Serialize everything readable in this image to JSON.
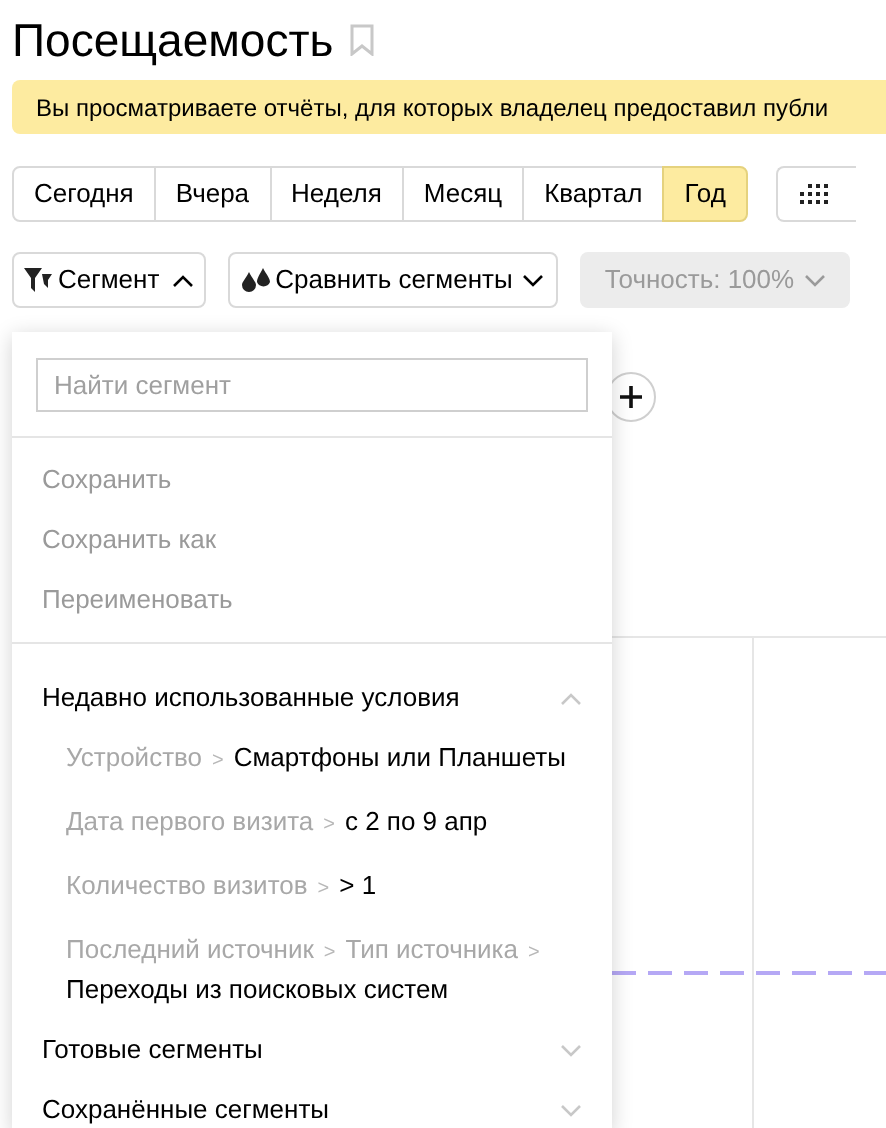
{
  "title": "Посещаемость",
  "banner": "Вы просматриваете отчёты, для которых владелец предоставил публи",
  "periods": [
    {
      "label": "Сегодня",
      "selected": false
    },
    {
      "label": "Вчера",
      "selected": false
    },
    {
      "label": "Неделя",
      "selected": false
    },
    {
      "label": "Месяц",
      "selected": false
    },
    {
      "label": "Квартал",
      "selected": false
    },
    {
      "label": "Год",
      "selected": true
    }
  ],
  "toolbar": {
    "segment": {
      "label": "Сегмент",
      "expanded": true
    },
    "compare": {
      "label": "Сравнить сегменты",
      "expanded": false
    },
    "accuracy": {
      "label": "Точность: 100%",
      "disabled": true
    }
  },
  "dropdown": {
    "search": {
      "placeholder": "Найти сегмент"
    },
    "actions": [
      {
        "label": "Сохранить",
        "disabled": true
      },
      {
        "label": "Сохранить как",
        "disabled": true
      },
      {
        "label": "Переименовать",
        "disabled": true
      }
    ],
    "sections": [
      {
        "title": "Недавно использованные условия",
        "expanded": true,
        "conditions": [
          {
            "parts": [
              {
                "kind": "field",
                "text": "Устройство"
              },
              {
                "kind": "separator",
                "text": ">"
              },
              {
                "kind": "value",
                "text": "Смартфоны или Планшеты"
              }
            ]
          },
          {
            "parts": [
              {
                "kind": "field",
                "text": "Дата первого визита"
              },
              {
                "kind": "separator",
                "text": ">"
              },
              {
                "kind": "value",
                "text": "с 2 по 9 апр"
              }
            ]
          },
          {
            "parts": [
              {
                "kind": "field",
                "text": "Количество визитов"
              },
              {
                "kind": "separator",
                "text": ">"
              },
              {
                "kind": "value",
                "text": "> 1"
              }
            ]
          },
          {
            "parts": [
              {
                "kind": "field",
                "text": "Последний источник"
              },
              {
                "kind": "separator",
                "text": ">"
              },
              {
                "kind": "field",
                "text": "Тип источника"
              },
              {
                "kind": "separator",
                "text": ">"
              },
              {
                "kind": "value",
                "text": "Переходы из поисковых систем"
              }
            ]
          }
        ]
      },
      {
        "title": "Готовые сегменты",
        "expanded": false
      },
      {
        "title": "Сохранённые сегменты",
        "expanded": false
      }
    ]
  }
}
